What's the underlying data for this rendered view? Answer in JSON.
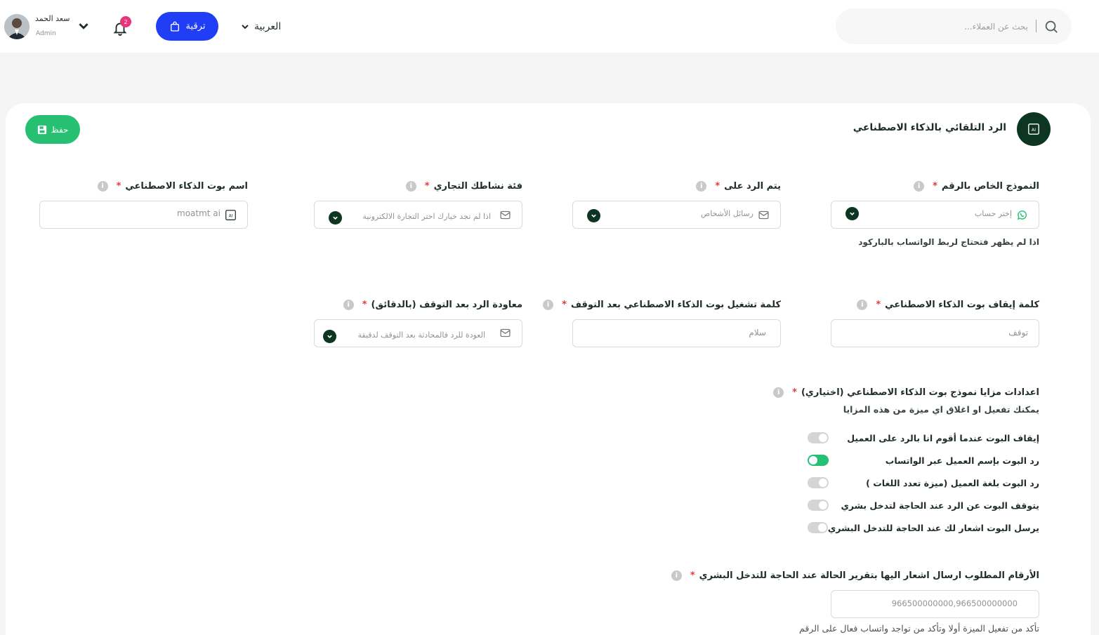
{
  "header": {
    "search_placeholder": "بحث عن العملاء...",
    "language": "العربية",
    "upgrade_label": "ترقية",
    "notifications_count": "2",
    "user": {
      "name": "سعد الحمد",
      "role": "Admin"
    }
  },
  "page": {
    "title": "الرد التلقائي بالذكاء الاصطناعي",
    "save_label": "حفظ",
    "ai_badge": "AI"
  },
  "fields": [
    {
      "label": "النموذج الخاص بالرقم",
      "value": "إختر حساب",
      "icon": "whatsapp-icon",
      "hint": "اذا لم يظهر فتحتاج لربط الواتساب بالباركود"
    },
    {
      "label": "يتم الرد على",
      "value": "رسائل الأشخاص",
      "icon": "mail-icon"
    },
    {
      "label": "فئة نشاطك التجاري",
      "value": "اذا لم تجد خيارك اختر التجارة الالكترونية",
      "icon": "mail-icon"
    },
    {
      "label": "اسم بوت الذكاء الاصطناعي",
      "value": "moatmt ai",
      "icon": "ai-icon"
    },
    {
      "label": "كلمة إيقاف بوت الذكاء الاصطناعي",
      "value": "توقف"
    },
    {
      "label": "كلمة تشغيل بوت الذكاء الاصطناعي بعد التوقف",
      "value": "سلام"
    },
    {
      "label": "معاودة الرد بعد التوقف (بالدقائق)",
      "value": "العودة للرد فالمحادثة بعد التوقف لدقيقة",
      "icon": "mail-icon"
    }
  ],
  "required_mark": "*",
  "info_mark": "i",
  "features": {
    "title": "اعدادات مزايا نموذج بوت الذكاء الاصطناعي (اختياري)",
    "subtitle": "يمكنك تفعيل او اغلاق اي ميزة من هذه المزايا",
    "items": [
      {
        "label": "إيقاف البوت عندما أقوم انا بالرد على العميل",
        "on": false
      },
      {
        "label": "رد البوت بإسم العميل عبر الواتساب",
        "on": true
      },
      {
        "label": "رد البوت بلغة العميل (ميزة تعدد اللغات )",
        "on": false
      },
      {
        "label": "يتوقف البوت عن الرد عند الحاجة لتدخل بشري",
        "on": false
      },
      {
        "label": "يرسل البوت اشعار لك عند الحاجة للتدخل البشري",
        "on": false
      }
    ]
  },
  "notify_numbers": {
    "label": "الأرقام المطلوب ارسال اشعار اليها بتقرير الحالة عند الحاجة للتدخل البشري",
    "value": "966500000000,966500000000",
    "hint": "تأكد من تفعيل الميزة أولا وتأكد من تواجد واتساب فعال على الرقم"
  },
  "colors": {
    "brand_dark": "#0d3522",
    "accent_green": "#27c073",
    "upgrade_blue": "#1f3ef5",
    "required_red": "#e23b3b"
  }
}
